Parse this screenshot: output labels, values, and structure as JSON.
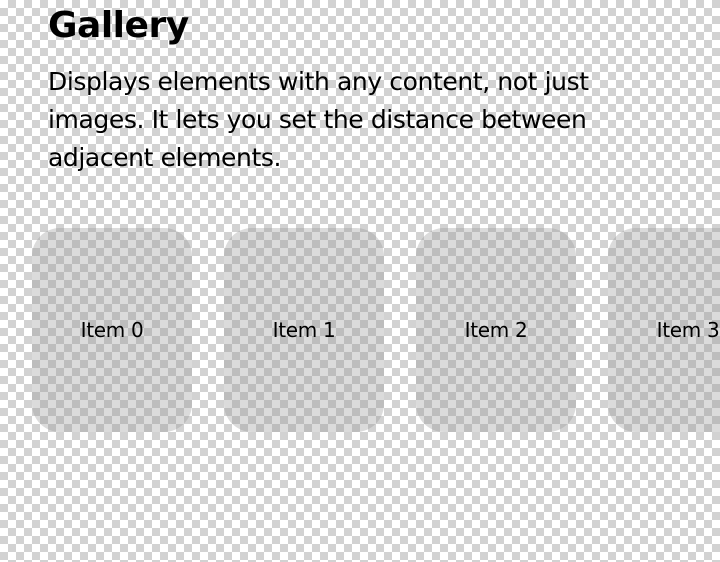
{
  "page": {
    "title": "Gallery",
    "description": "Displays elements with any content, not just images. It lets you set the distance between adjacent elements."
  },
  "gallery": {
    "items": [
      {
        "label": "Item 0"
      },
      {
        "label": "Item 1"
      },
      {
        "label": "Item 2"
      },
      {
        "label": "Item 3"
      }
    ]
  }
}
